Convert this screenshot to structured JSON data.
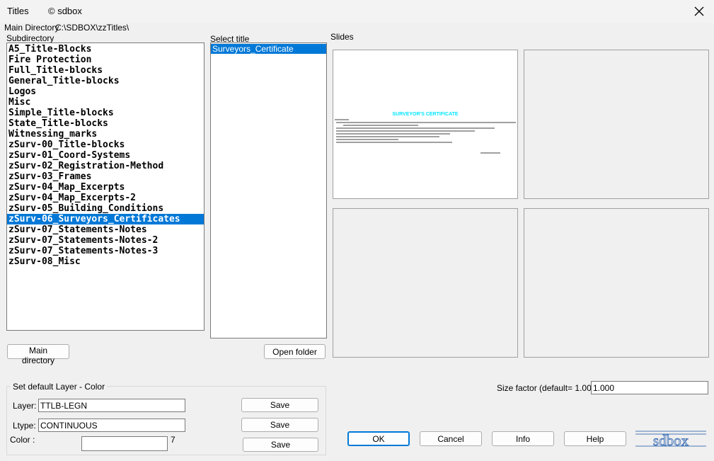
{
  "window": {
    "title": "Titles",
    "copyright": "© sdbox"
  },
  "main_directory": {
    "label": "Main Directory",
    "path": "C:\\SDBOX\\zzTitles\\"
  },
  "subdirectory": {
    "label": "Subdirectory",
    "items": [
      "A5_Title-Blocks",
      "Fire Protection",
      "Full_Title-blocks",
      "General_Title-blocks",
      "Logos",
      "Misc",
      "Simple_Title-blocks",
      "State_Title-blocks",
      "Witnessing_marks",
      "zSurv-00_Title-blocks",
      "zSurv-01_Coord-Systems",
      "zSurv-02_Registration-Method",
      "zSurv-03_Frames",
      "zSurv-04_Map_Excerpts",
      "zSurv-04_Map_Excerpts-2",
      "zSurv-05_Building_Conditions",
      "zSurv-06_Surveyors_Certificates",
      "zSurv-07_Statements-Notes",
      "zSurv-07_Statements-Notes-2",
      "zSurv-07_Statements-Notes-3",
      "zSurv-08_Misc"
    ],
    "selected_index": 16
  },
  "select_title": {
    "label": "Select title",
    "items": [
      "Surveyors_Certificate"
    ],
    "selected_index": 0
  },
  "slides": {
    "label": "Slides",
    "preview_heading": "SURVEYOR'S CERTIFICATE"
  },
  "buttons": {
    "main_directory": "Main directory",
    "open_folder": "Open folder",
    "ok": "OK",
    "cancel": "Cancel",
    "info": "Info",
    "help": "Help"
  },
  "layer_group": {
    "title": "Set default Layer - Color",
    "layer_label": "Layer:",
    "layer_value": "TTLB-LEGN",
    "ltype_label": "Ltype:",
    "ltype_value": "CONTINUOUS",
    "color_label": "Color  :",
    "color_value": "",
    "color_number": "7",
    "save_label": "Save"
  },
  "size_factor": {
    "label": "Size factor  (default= 1.00):",
    "value": "1.000"
  },
  "logo": {
    "text": "sdbox"
  },
  "colors": {
    "selection": "#0078d7",
    "preview_heading": "#00e5ff"
  }
}
